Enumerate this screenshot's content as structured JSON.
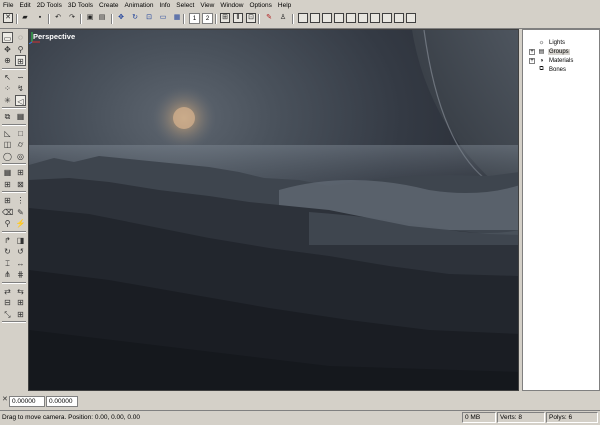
{
  "menu": [
    "File",
    "Edit",
    "2D Tools",
    "3D Tools",
    "Create",
    "Animation",
    "Info",
    "Select",
    "View",
    "Window",
    "Options",
    "Help"
  ],
  "toolbar": {
    "num1": "1",
    "num2": "2",
    "buttons": [
      {
        "name": "close-icon",
        "glyph": "✕"
      },
      {
        "name": "open-folder-icon",
        "glyph": "▰"
      },
      {
        "name": "save-icon",
        "glyph": "▪"
      },
      {
        "name": "undo-icon",
        "glyph": "↶"
      },
      {
        "name": "redo-icon",
        "glyph": "↷"
      },
      {
        "name": "copy-icon",
        "glyph": "▣"
      },
      {
        "name": "paste-icon",
        "glyph": "▤"
      },
      {
        "name": "move-icon",
        "glyph": "✥"
      },
      {
        "name": "rotate-icon",
        "glyph": "↻"
      },
      {
        "name": "scale-icon",
        "glyph": "⊡"
      },
      {
        "name": "select-box-icon",
        "glyph": "▭"
      },
      {
        "name": "grid-icon",
        "glyph": "▦"
      },
      {
        "name": "frame-icon",
        "glyph": "⊞"
      },
      {
        "name": "text-icon",
        "glyph": "Ⅱ"
      },
      {
        "name": "lock-icon",
        "glyph": "⊡"
      },
      {
        "name": "dropper-icon",
        "glyph": "✎"
      },
      {
        "name": "paint-icon",
        "glyph": "♙"
      }
    ],
    "views": [
      "single-view-icon",
      "split-vertical-icon",
      "split-horizontal-icon",
      "split-left-icon",
      "split-right-icon",
      "split-top-icon",
      "split-bottom-icon",
      "split-three-icon",
      "split-four-icon",
      "split-four-alt-icon"
    ]
  },
  "left_tools": [
    {
      "name": "select-rect-tool-icon",
      "glyph": "▭",
      "sel": true
    },
    {
      "name": "lasso-tool-icon",
      "glyph": "◌",
      "sel": false
    },
    {
      "name": "move-tool-icon",
      "glyph": "✥",
      "sel": false
    },
    {
      "name": "zoom-tool-icon",
      "glyph": "⚲",
      "sel": false
    },
    {
      "name": "zoom-region-tool-icon",
      "glyph": "⊕",
      "sel": false
    },
    {
      "name": "zoom-fit-tool-icon",
      "glyph": "⊞",
      "sel": true
    },
    {
      "name": "vertex-select-tool-icon",
      "glyph": "↖",
      "sel": false
    },
    {
      "name": "link-tool-icon",
      "glyph": "∽",
      "sel": false
    },
    {
      "name": "weld-tool-icon",
      "glyph": "⁘",
      "sel": false
    },
    {
      "name": "extrude-tool-icon",
      "glyph": "↯",
      "sel": false
    },
    {
      "name": "star-tool-icon",
      "glyph": "✳",
      "sel": false
    },
    {
      "name": "pointer-tool-icon",
      "glyph": "◁",
      "sel": true
    },
    {
      "name": "duplicate-tool-icon",
      "glyph": "⧉",
      "sel": false
    },
    {
      "name": "grid-tool-icon",
      "glyph": "▦",
      "sel": false
    },
    {
      "name": "triangle-tool-icon",
      "glyph": "◺",
      "sel": false
    },
    {
      "name": "box-tool-icon",
      "glyph": "□",
      "sel": false
    },
    {
      "name": "cube-tool-icon",
      "glyph": "◫",
      "sel": false
    },
    {
      "name": "cylinder-tool-icon",
      "glyph": "⌭",
      "sel": false
    },
    {
      "name": "sphere-tool-icon",
      "glyph": "◯",
      "sel": false
    },
    {
      "name": "torus-tool-icon",
      "glyph": "◎",
      "sel": false
    },
    {
      "name": "grid-create-tool-icon",
      "glyph": "▦",
      "sel": false
    },
    {
      "name": "plane-tool-icon",
      "glyph": "⊞",
      "sel": false
    },
    {
      "name": "subdivide-tool-icon",
      "glyph": "⊞",
      "sel": false
    },
    {
      "name": "mesh-tool-icon",
      "glyph": "⊠",
      "sel": false
    },
    {
      "name": "grid-small-tool-icon",
      "glyph": "⊞",
      "sel": false
    },
    {
      "name": "cut-tool-icon",
      "glyph": "⋮",
      "sel": false
    },
    {
      "name": "eraser-tool-icon",
      "glyph": "⌫",
      "sel": false
    },
    {
      "name": "pencil-tool-icon",
      "glyph": "✎",
      "sel": false
    },
    {
      "name": "pin-tool-icon",
      "glyph": "⚲",
      "sel": false
    },
    {
      "name": "wand-tool-icon",
      "glyph": "⚡",
      "sel": false
    },
    {
      "name": "bend-tool-icon",
      "glyph": "↱",
      "sel": false
    },
    {
      "name": "camera-tool-icon",
      "glyph": "◨",
      "sel": false
    },
    {
      "name": "rotate-tool-icon",
      "glyph": "↻",
      "sel": false
    },
    {
      "name": "rotate-back-tool-icon",
      "glyph": "↺",
      "sel": false
    },
    {
      "name": "taper-tool-icon",
      "glyph": "⌶",
      "sel": false
    },
    {
      "name": "stretch-tool-icon",
      "glyph": "↔",
      "sel": false
    },
    {
      "name": "array-tool-icon",
      "glyph": "⋔",
      "sel": false
    },
    {
      "name": "array-alt-tool-icon",
      "glyph": "⋕",
      "sel": false
    },
    {
      "name": "mirror-tool-icon",
      "glyph": "⇄",
      "sel": false
    },
    {
      "name": "flip-tool-icon",
      "glyph": "⇆",
      "sel": false
    },
    {
      "name": "align-tool-icon",
      "glyph": "⊟",
      "sel": false
    },
    {
      "name": "distribute-tool-icon",
      "glyph": "⊞",
      "sel": false
    },
    {
      "name": "scale-tool-icon",
      "glyph": "⤡",
      "sel": false
    },
    {
      "name": "grid-four-tool-icon",
      "glyph": "⊞",
      "sel": false
    }
  ],
  "viewport": {
    "label": "Perspective"
  },
  "tree": [
    {
      "label": "Lights",
      "expand": false,
      "icon": "light-icon",
      "glyph": "☼",
      "hl": false
    },
    {
      "label": "Groups",
      "expand": true,
      "icon": "groups-icon",
      "glyph": "▤",
      "hl": true
    },
    {
      "label": "Materials",
      "expand": true,
      "icon": "materials-icon",
      "glyph": "◑",
      "hl": false
    },
    {
      "label": "Bones",
      "expand": false,
      "icon": "bones-icon",
      "glyph": "⧉",
      "hl": false
    }
  ],
  "coords": {
    "x_label": "✕",
    "value1": "0.00000",
    "value2": "0.00000"
  },
  "status": {
    "message": "Drag to move camera. Position: 0.00, 0.00, 0.00",
    "memory": "0 MB",
    "verts": "Verts: 8",
    "polys": "Polys: 6"
  }
}
